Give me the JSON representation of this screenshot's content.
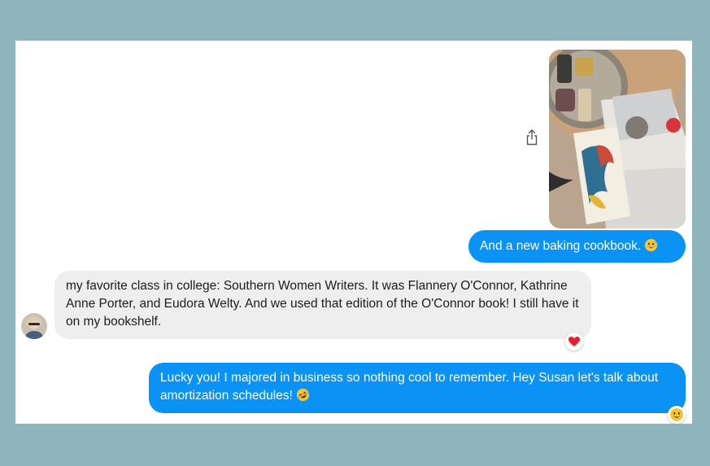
{
  "messages": [
    {
      "direction": "outgoing",
      "type": "image",
      "description": "Photo of The Complete Stories by Flannery O'Connor book and a baking cookbook on a table"
    },
    {
      "direction": "outgoing",
      "type": "text",
      "text": "And a new baking cookbook.",
      "emoji": "grinning-face-with-sweat"
    },
    {
      "direction": "incoming",
      "type": "text",
      "text": "my favorite class in college: Southern Women Writers. It was Flannery O'Connor, Kathrine Anne Porter, and Eudora Welty. And we used that edition of the O'Connor book! I still have it on my bookshelf.",
      "reaction": "red-heart"
    },
    {
      "direction": "outgoing",
      "type": "text",
      "text": "Lucky you! I majored in business so nothing cool to remember. Hey Susan let's talk about amortization schedules!",
      "emoji": "rolling-on-floor-laughing",
      "reaction": "grinning-face-with-sweat"
    }
  ],
  "colors": {
    "outgoing_bubble": "#0a93f4",
    "incoming_bubble": "#eeeeee",
    "background": "#8eb5bd",
    "heart": "#e5202f"
  },
  "icons": {
    "share": "share-icon",
    "avatar": "contact-avatar"
  }
}
